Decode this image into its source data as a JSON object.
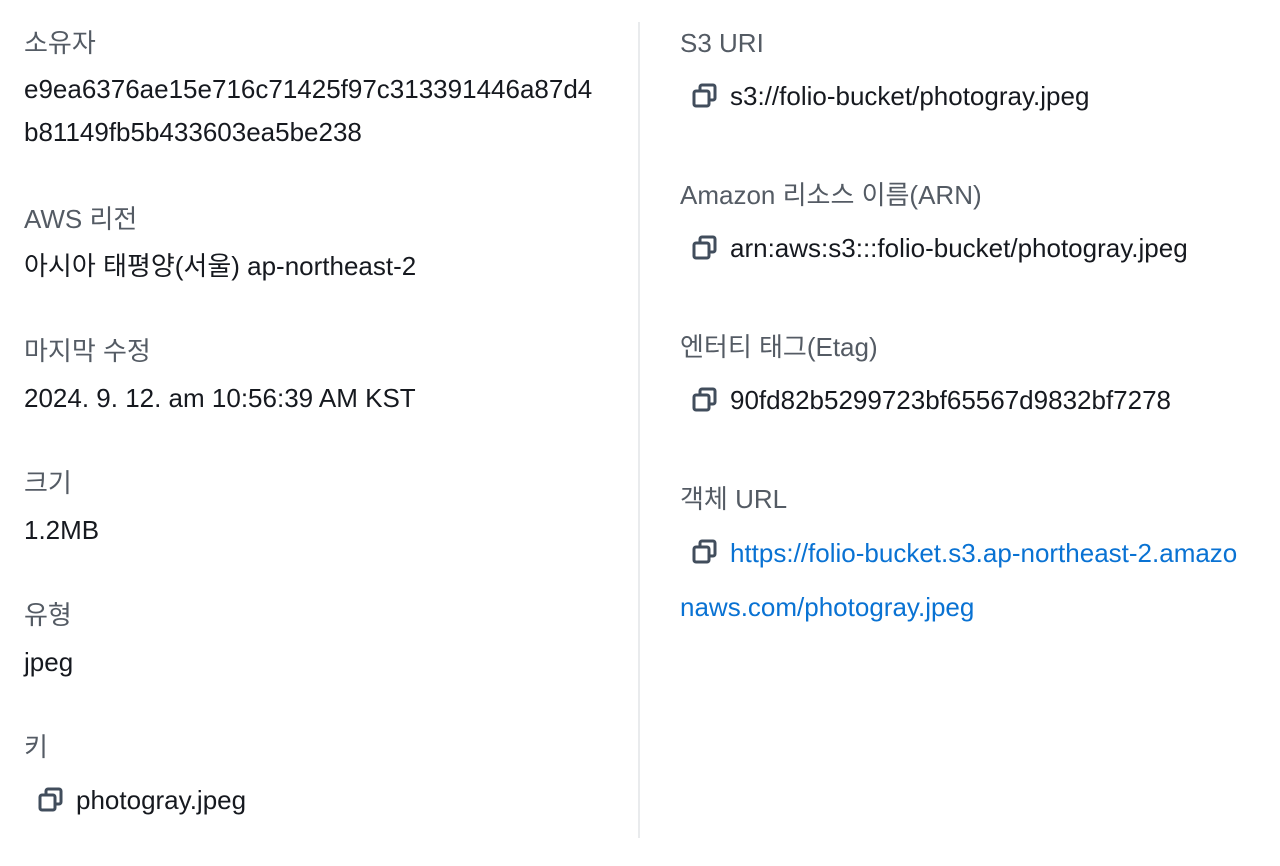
{
  "left": {
    "owner": {
      "label": "소유자",
      "value": "e9ea6376ae15e716c71425f97c313391446a87d4b81149fb5b433603ea5be238"
    },
    "region": {
      "label": "AWS 리전",
      "value": "아시아 태평양(서울) ap-northeast-2"
    },
    "last_modified": {
      "label": "마지막 수정",
      "value": "2024. 9. 12. am 10:56:39 AM KST"
    },
    "size": {
      "label": "크기",
      "value": "1.2MB"
    },
    "type": {
      "label": "유형",
      "value": "jpeg"
    },
    "key": {
      "label": "키",
      "value": "photogray.jpeg",
      "copy_icon": "copy-icon"
    }
  },
  "right": {
    "s3_uri": {
      "label": "S3 URI",
      "value": "s3://folio-bucket/photogray.jpeg",
      "copy_icon": "copy-icon"
    },
    "arn": {
      "label": "Amazon 리소스 이름(ARN)",
      "value": "arn:aws:s3:::folio-bucket/photogray.jpeg",
      "copy_icon": "copy-icon"
    },
    "etag": {
      "label": "엔터티 태그(Etag)",
      "value": "90fd82b5299723bf65567d9832bf7278",
      "copy_icon": "copy-icon"
    },
    "object_url": {
      "label": "객체 URL",
      "value": "https://folio-bucket.s3.ap-northeast-2.amazonaws.com/photogray.jpeg",
      "copy_icon": "copy-icon"
    }
  },
  "colors": {
    "label": "#545b64",
    "text": "#16191f",
    "link": "#0972d3",
    "divider": "#e9ebed"
  }
}
